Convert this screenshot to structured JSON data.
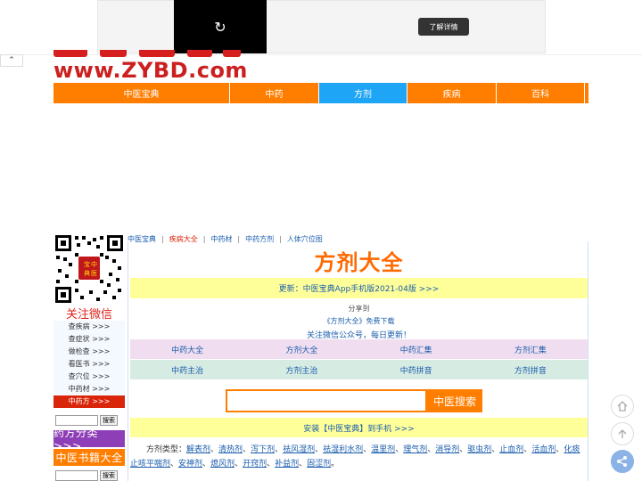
{
  "ad": {
    "more_label": "了解详情",
    "replay_icon": "replay-icon"
  },
  "collapse_icon": "chevron-up-icon",
  "collapse_glyph": "⌃",
  "logo": {
    "text": "www.ZYBD.com"
  },
  "nav": {
    "items": [
      {
        "label": "中医宝典",
        "active": false
      },
      {
        "label": "中药",
        "active": false
      },
      {
        "label": "方剂",
        "active": true
      },
      {
        "label": "疾病",
        "active": false
      },
      {
        "label": "百科",
        "active": false
      }
    ]
  },
  "sidebar": {
    "follow_label": "关注微信",
    "links": [
      {
        "label": "查疾病 >>>",
        "active": false
      },
      {
        "label": "查症状 >>>",
        "active": false
      },
      {
        "label": "做检查 >>>",
        "active": false
      },
      {
        "label": "看医书 >>>",
        "active": false
      },
      {
        "label": "查穴位 >>>",
        "active": false
      },
      {
        "label": "中药材 >>>",
        "active": false
      },
      {
        "label": "中药方 >>>",
        "active": true
      }
    ],
    "search_button": "搜索",
    "cat_formula": "药方分类 >>>",
    "cat_books": "中医书籍大全"
  },
  "breadcrumb": {
    "items": [
      "中医宝典",
      "疾病大全",
      "中药材",
      "中药方剂",
      "人体穴位图"
    ]
  },
  "main": {
    "title": "方剂大全",
    "update_text": "更新：中医宝典App手机版2021-04版 >>>",
    "share_text": "分享到",
    "free_download": "《方剂大全》免费下载",
    "wechat_text": "关注微信公众号，每日更新！",
    "grid": [
      {
        "label": "中药大全",
        "tone": "pink"
      },
      {
        "label": "方剂大全",
        "tone": "pink"
      },
      {
        "label": "中药汇集",
        "tone": "pink"
      },
      {
        "label": "方剂汇集",
        "tone": "pink"
      },
      {
        "label": "中药主治",
        "tone": "green"
      },
      {
        "label": "方剂主治",
        "tone": "green"
      },
      {
        "label": "中药拼音",
        "tone": "green"
      },
      {
        "label": "方剂拼音",
        "tone": "green"
      }
    ],
    "search_button": "中医搜索",
    "install_text": "安装【中医宝典】到手机 >>>",
    "types_label": "方剂类型：",
    "types": [
      "解表剂",
      "清热剂",
      "泻下剂",
      "祛风湿剂",
      "祛湿利水剂",
      "温里剂",
      "理气剂",
      "消导剂",
      "驱虫剂",
      "止血剂",
      "活血剂",
      "化痰止咳平喘剂",
      "安神剂",
      "熄风剂",
      "开窍剂",
      "补益剂",
      "固涩剂"
    ]
  },
  "floating": {
    "home_icon": "home-icon",
    "top_icon": "back-to-top-icon",
    "share_icon": "share-icon"
  },
  "colors": {
    "nav_orange": "#ff7e00",
    "nav_active": "#1ea5f5",
    "logo_red": "#cc1f1f",
    "title_orange": "#ff6a00",
    "link_blue": "#1a5dad",
    "highlight_yellow": "#ffff99"
  }
}
